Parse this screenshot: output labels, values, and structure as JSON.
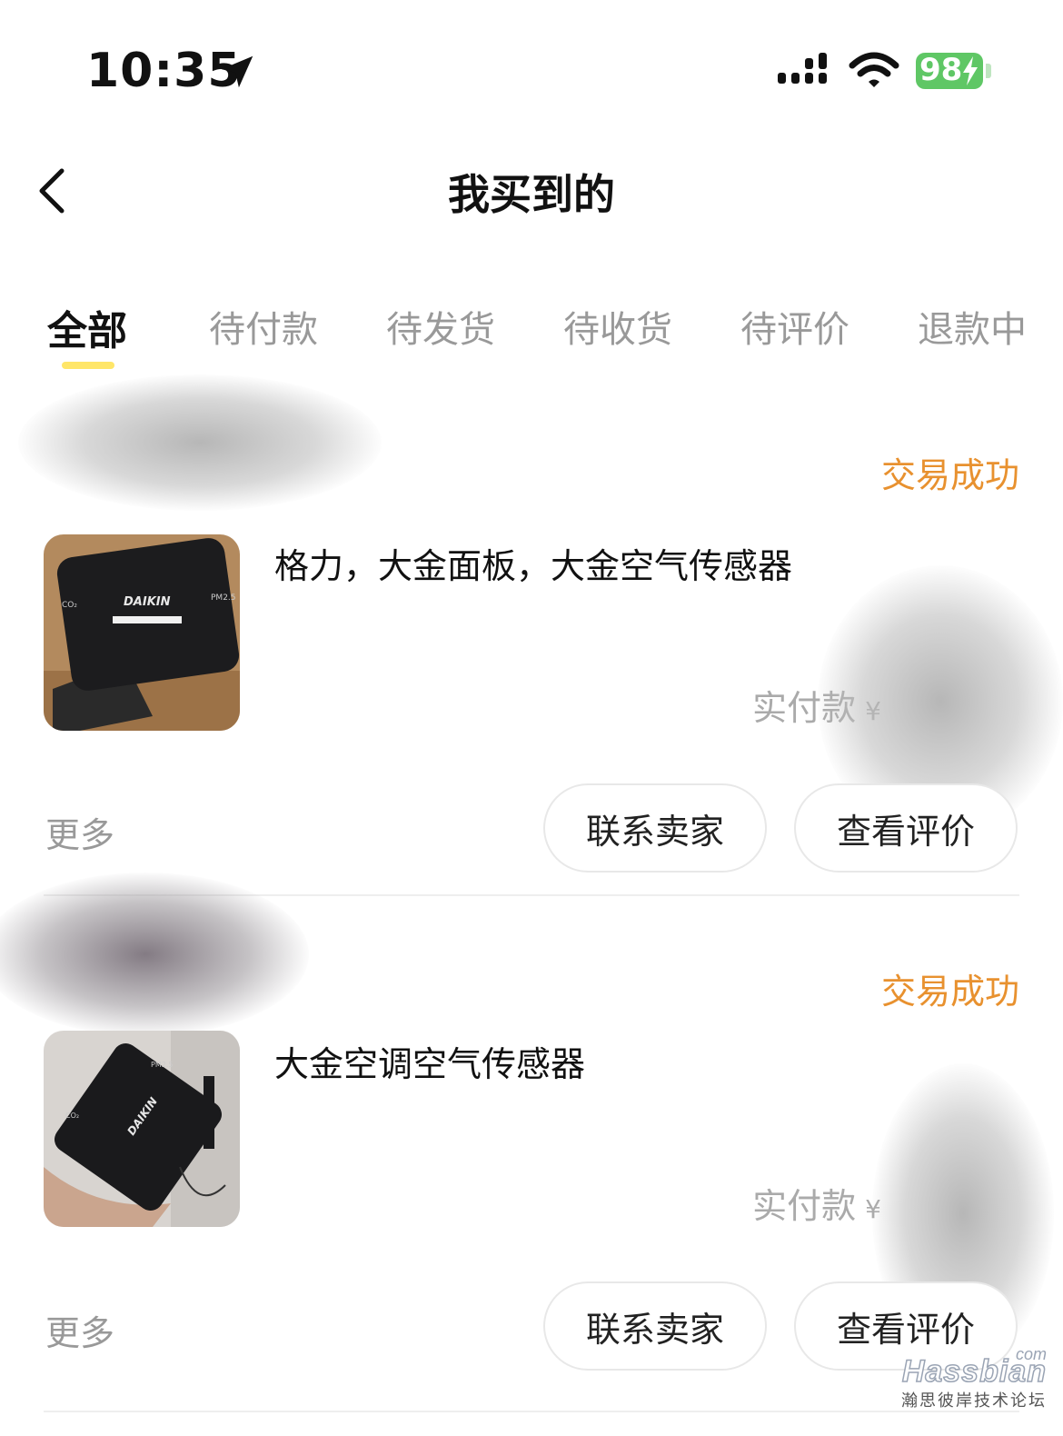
{
  "status_bar": {
    "time": "10:35",
    "battery": "98"
  },
  "nav": {
    "title": "我买到的"
  },
  "tabs": [
    {
      "label": "全部",
      "active": true
    },
    {
      "label": "待付款",
      "active": false
    },
    {
      "label": "待发货",
      "active": false
    },
    {
      "label": "待收货",
      "active": false
    },
    {
      "label": "待评价",
      "active": false
    },
    {
      "label": "退款中",
      "active": false
    }
  ],
  "orders": [
    {
      "status": "交易成功",
      "product_title": "格力，大金面板，大金空气传感器",
      "pay_label": "实付款",
      "pay_currency": "¥",
      "more_label": "更多",
      "contact_label": "联系卖家",
      "review_label": "查看评价",
      "thumb_brand": "DAIKIN",
      "thumb_left_label": "CO₂",
      "thumb_right_label": "PM2.5"
    },
    {
      "status": "交易成功",
      "product_title": "大金空调空气传感器",
      "pay_label": "实付款",
      "pay_currency": "¥",
      "more_label": "更多",
      "contact_label": "联系卖家",
      "review_label": "查看评价",
      "thumb_brand": "DAIKIN",
      "thumb_left_label": "CO₂",
      "thumb_right_label": "PM2.5"
    }
  ],
  "colors": {
    "status_success": "#e8912f",
    "tab_underline": "#ffe24d",
    "battery": "#5fc765"
  },
  "watermark": {
    "brand": "Hassbian",
    "com": "com",
    "subtitle": "瀚思彼岸技术论坛"
  }
}
